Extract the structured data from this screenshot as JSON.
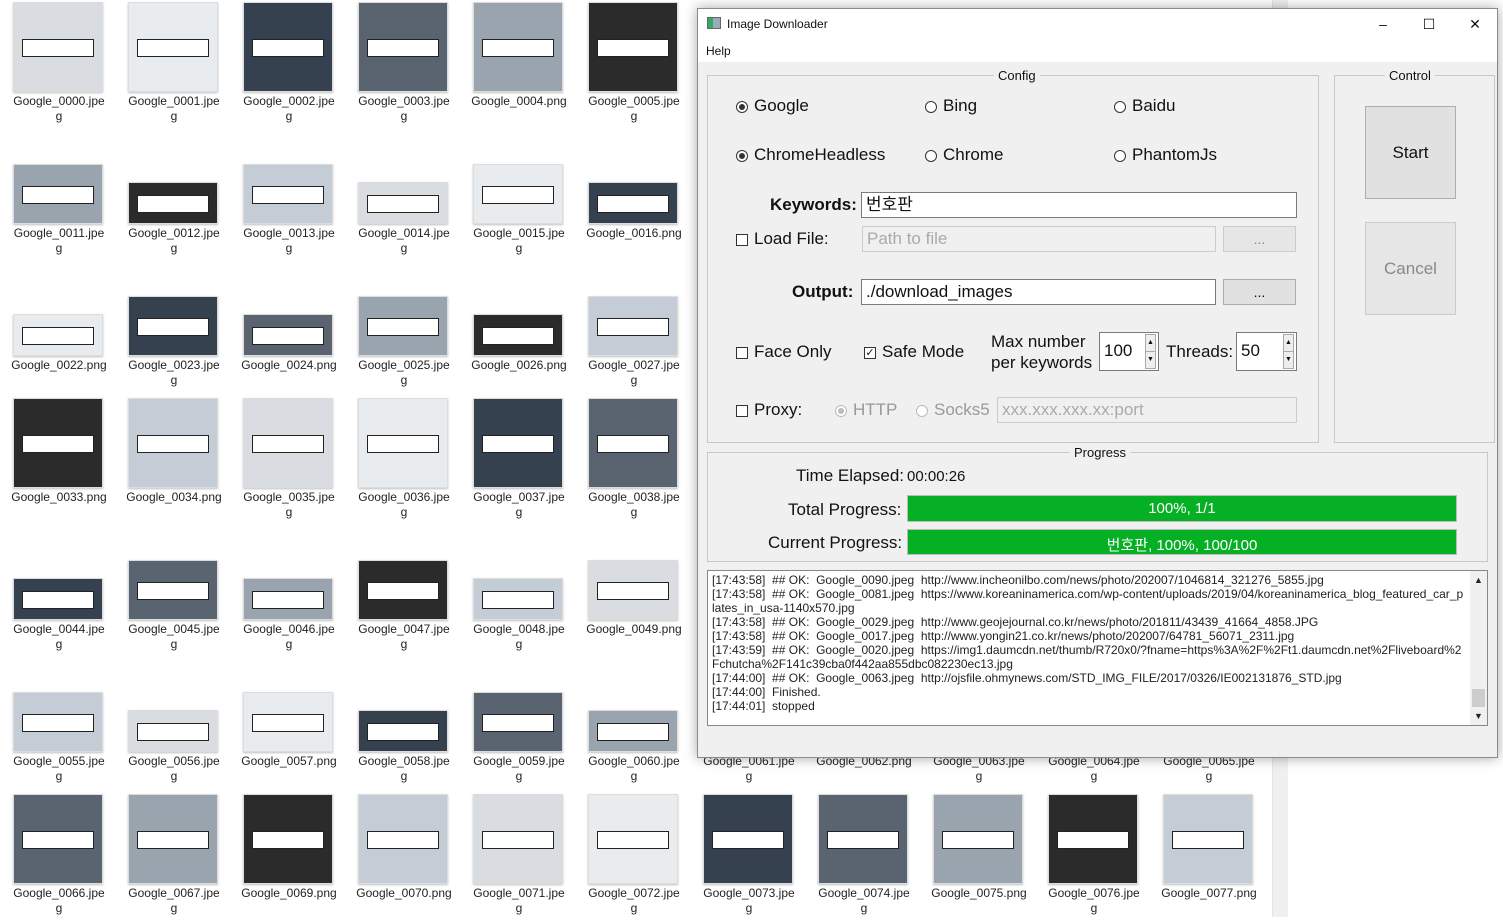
{
  "explorer": {
    "rows": [
      [
        "Google_0000.jpeg",
        "Google_0001.jpeg",
        "Google_0002.jpeg",
        "Google_0003.jpeg",
        "Google_0004.png",
        "Google_0005.jpeg"
      ],
      [
        "Google_0011.jpeg",
        "Google_0012.jpeg",
        "Google_0013.jpeg",
        "Google_0014.jpeg",
        "Google_0015.jpeg",
        "Google_0016.png"
      ],
      [
        "Google_0022.png",
        "Google_0023.jpeg",
        "Google_0024.png",
        "Google_0025.jpeg",
        "Google_0026.png",
        "Google_0027.jpeg"
      ],
      [
        "Google_0033.png",
        "Google_0034.png",
        "Google_0035.jpeg",
        "Google_0036.jpeg",
        "Google_0037.jpeg",
        "Google_0038.jpeg"
      ],
      [
        "Google_0044.jpeg",
        "Google_0045.jpeg",
        "Google_0046.jpeg",
        "Google_0047.jpeg",
        "Google_0048.jpeg",
        "Google_0049.png"
      ],
      [
        "Google_0055.jpeg",
        "Google_0056.jpeg",
        "Google_0057.png",
        "Google_0058.jpeg",
        "Google_0059.jpeg",
        "Google_0060.jpeg",
        "Google_0061.jpeg",
        "Google_0062.png",
        "Google_0063.jpeg",
        "Google_0064.jpeg",
        "Google_0065.jpeg"
      ],
      [
        "Google_0066.jpeg",
        "Google_0067.jpeg",
        "Google_0069.png",
        "Google_0070.png",
        "Google_0071.jpeg",
        "Google_0072.jpeg",
        "Google_0073.jpeg",
        "Google_0074.jpeg",
        "Google_0075.png",
        "Google_0076.jpeg",
        "Google_0077.png"
      ]
    ]
  },
  "window": {
    "title": "Image Downloader",
    "minimize": "–",
    "maximize": "☐",
    "close": "✕",
    "menu": "Help"
  },
  "config": {
    "title": "Config",
    "engines": [
      "Google",
      "Bing",
      "Baidu"
    ],
    "drivers": [
      "ChromeHeadless",
      "Chrome",
      "PhantomJs"
    ],
    "keywords_label": "Keywords:",
    "keywords_value": "번호판",
    "load_file_label": "Load File:",
    "load_file_placeholder": "Path to file",
    "browse": "...",
    "output_label": "Output:",
    "output_value": "./download_images",
    "face_only": "Face Only",
    "safe_mode": "Safe Mode",
    "safe_mode_checked": true,
    "max_label_1": "Max number",
    "max_label_2": "per keywords",
    "max_value": "100",
    "threads_label": "Threads:",
    "threads_value": "50",
    "proxy_label": "Proxy:",
    "proxy_http": "HTTP",
    "proxy_socks": "Socks5",
    "proxy_placeholder": "xxx.xxx.xxx.xx:port"
  },
  "control": {
    "title": "Control",
    "start": "Start",
    "cancel": "Cancel"
  },
  "progress": {
    "title": "Progress",
    "time_label": "Time Elapsed:",
    "time_value": "00:00:26",
    "total_label": "Total Progress:",
    "total_text": "100%, 1/1",
    "total_percent": 100,
    "current_label": "Current Progress:",
    "current_text": "번호판, 100%, 100/100",
    "current_percent": 100,
    "bar_color": "#06b025"
  },
  "log": [
    "[17:43:58]  ## OK:  Google_0090.jpeg  http://www.incheonilbo.com/news/photo/202007/1046814_321276_5855.jpg",
    "[17:43:58]  ## OK:  Google_0081.jpeg  https://www.koreaninamerica.com/wp-content/uploads/2019/04/koreaninamerica_blog_featured_car_plates_in_usa-1140x570.jpg",
    "[17:43:58]  ## OK:  Google_0029.jpeg  http://www.geojejournal.co.kr/news/photo/201811/43439_41664_4858.JPG",
    "[17:43:58]  ## OK:  Google_0017.jpeg  http://www.yongin21.co.kr/news/photo/202007/64781_56071_2311.jpg",
    "[17:43:59]  ## OK:  Google_0020.jpeg  https://img1.daumcdn.net/thumb/R720x0/?fname=https%3A%2F%2Ft1.daumcdn.net%2Fliveboard%2Fchutcha%2F141c39cba0f442aa855dbc082230ec13.jpg",
    "[17:44:00]  ## OK:  Google_0063.jpeg  http://ojsfile.ohmynews.com/STD_IMG_FILE/2017/0326/IE002131876_STD.jpg",
    "[17:44:00]  Finished.",
    "[17:44:01]  stopped"
  ]
}
